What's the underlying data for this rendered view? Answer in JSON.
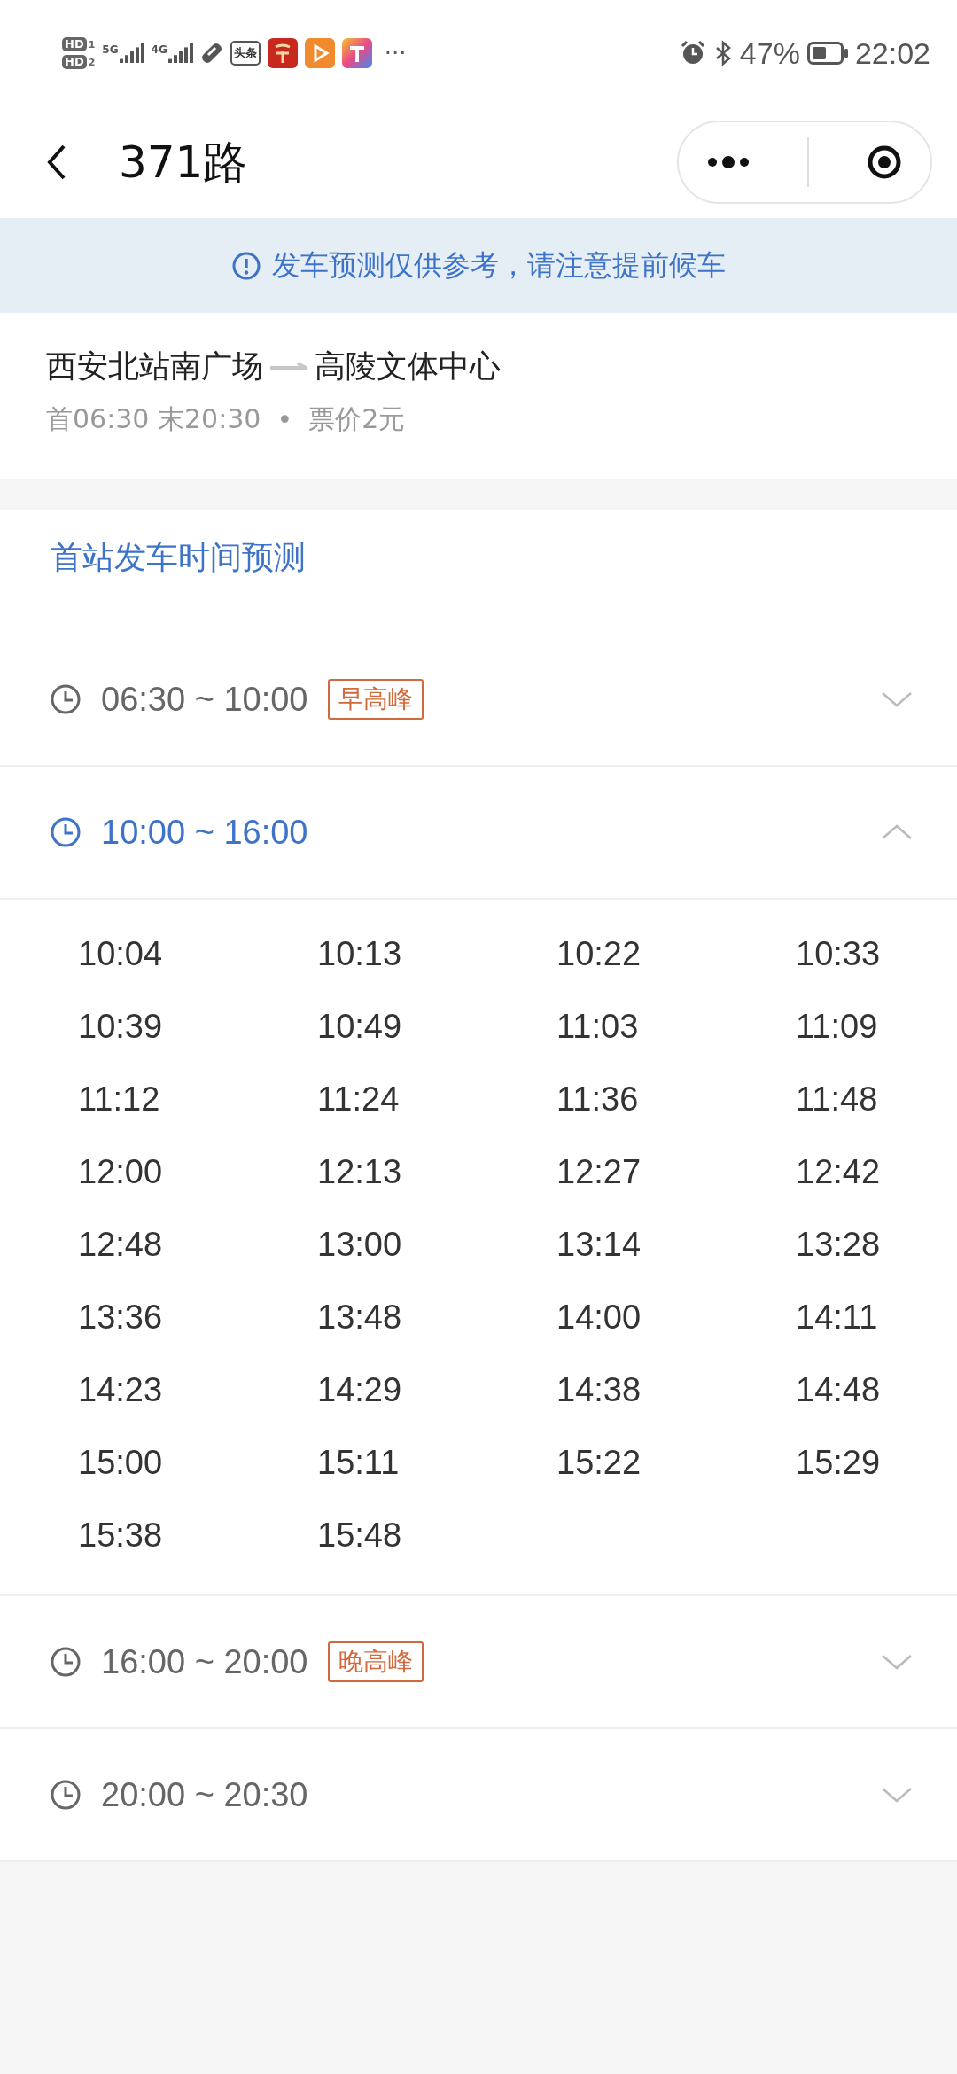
{
  "status_bar": {
    "sim_labels": [
      "HD",
      "HD"
    ],
    "sim_numbers": [
      "1",
      "2"
    ],
    "networks": [
      "5G",
      "4G"
    ],
    "app_badge": "头条",
    "more": "···",
    "battery_percent": "47%",
    "time": "22:02"
  },
  "nav": {
    "title": "371路"
  },
  "notice": {
    "text": "发车预测仅供参考，请注意提前候车"
  },
  "route": {
    "from": "西安北站南广场",
    "to": "高陵文体中心",
    "schedule": "首06:30 末20:30",
    "separator": "•",
    "fare": "票价2元"
  },
  "section": {
    "title": "首站发车时间预测"
  },
  "periods": [
    {
      "range": "06:30 ~ 10:00",
      "tag": "早高峰",
      "expanded": false
    },
    {
      "range": "10:00 ~ 16:00",
      "expanded": true,
      "times": [
        "10:04",
        "10:13",
        "10:22",
        "10:33",
        "10:39",
        "10:49",
        "11:03",
        "11:09",
        "11:12",
        "11:24",
        "11:36",
        "11:48",
        "12:00",
        "12:13",
        "12:27",
        "12:42",
        "12:48",
        "13:00",
        "13:14",
        "13:28",
        "13:36",
        "13:48",
        "14:00",
        "14:11",
        "14:23",
        "14:29",
        "14:38",
        "14:48",
        "15:00",
        "15:11",
        "15:22",
        "15:29",
        "15:38",
        "15:48"
      ]
    },
    {
      "range": "16:00 ~ 20:00",
      "tag": "晚高峰",
      "expanded": false
    },
    {
      "range": "20:00 ~ 20:30",
      "expanded": false
    }
  ]
}
